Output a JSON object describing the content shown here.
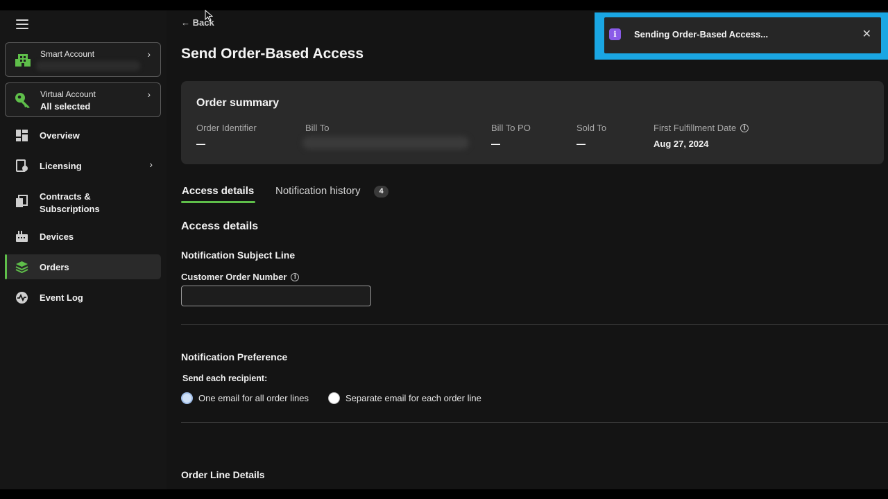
{
  "sidebar": {
    "smart_account": {
      "label": "Smart Account",
      "value": ""
    },
    "virtual_account": {
      "label": "Virtual Account",
      "value": "All selected"
    },
    "items": [
      {
        "label": "Overview"
      },
      {
        "label": "Licensing"
      },
      {
        "label": "Contracts & Subscriptions"
      },
      {
        "label": "Devices"
      },
      {
        "label": "Orders"
      },
      {
        "label": "Event Log"
      }
    ],
    "active_item": "Orders",
    "accent_color": "#5fbf4a"
  },
  "header": {
    "back_label": "Back",
    "title": "Send Order-Based Access"
  },
  "order_summary": {
    "title": "Order summary",
    "fields": [
      {
        "label": "Order Identifier",
        "value": "—"
      },
      {
        "label": "Bill To",
        "value": ""
      },
      {
        "label": "Bill To PO",
        "value": "—"
      },
      {
        "label": "Sold To",
        "value": "—"
      },
      {
        "label": "First Fulfillment Date",
        "value": "Aug 27, 2024"
      }
    ]
  },
  "tabs": [
    {
      "label": "Access details",
      "active": true
    },
    {
      "label": "Notification history",
      "badge": "4"
    }
  ],
  "access_details": {
    "heading": "Access details",
    "subject_heading": "Notification Subject Line",
    "customer_order_label": "Customer Order Number",
    "customer_order_value": "",
    "preference_heading": "Notification Preference",
    "send_each_label": "Send each recipient:",
    "options": [
      {
        "label": "One email for all order lines",
        "selected": true
      },
      {
        "label": "Separate email for each order line",
        "selected": false
      }
    ],
    "order_line_heading": "Order Line Details"
  },
  "toast": {
    "message": "Sending Order-Based Access...",
    "icon": "info-icon",
    "highlight_color": "#1aa6e3"
  }
}
